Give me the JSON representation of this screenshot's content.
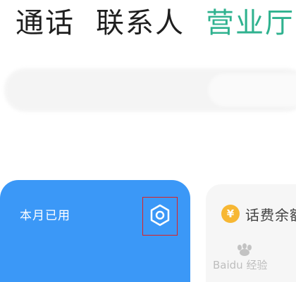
{
  "tabs": [
    {
      "label": "通话",
      "active": false
    },
    {
      "label": "联系人",
      "active": false
    },
    {
      "label": "营业厅",
      "active": true
    }
  ],
  "usage_card": {
    "title": "本月已用",
    "settings_icon": "hexagon-settings-icon",
    "color": "#3b98f7"
  },
  "balance_card": {
    "title": "话费余额",
    "icon": "yen-coin-icon",
    "icon_symbol": "¥"
  },
  "highlight_color": "#e02020",
  "accent_color": "#2fb28f",
  "watermark": {
    "text": "Baidu 经验",
    "logo": "baidu-paw-logo"
  }
}
